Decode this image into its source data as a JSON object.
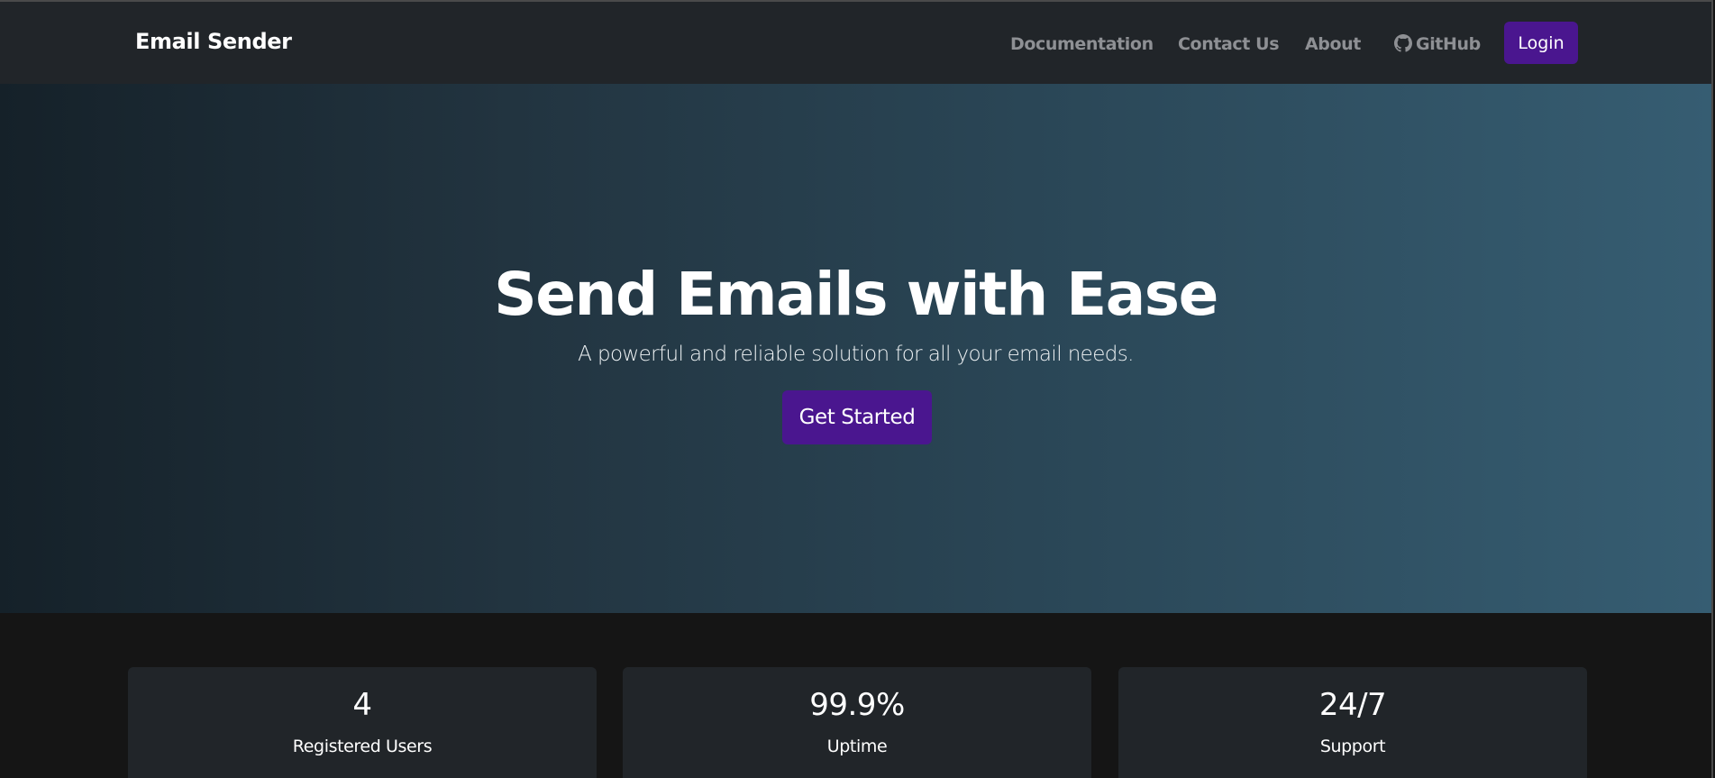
{
  "navbar": {
    "brand": "Email Sender",
    "links": {
      "documentation": "Documentation",
      "contact": "Contact Us",
      "about": "About",
      "github": "GitHub"
    },
    "github_icon": "github-icon",
    "login_label": "Login"
  },
  "hero": {
    "title": "Send Emails with Ease",
    "subtitle": "A powerful and reliable solution for all your email needs.",
    "cta_label": "Get Started"
  },
  "stats": [
    {
      "value": "4",
      "label": "Registered Users"
    },
    {
      "value": "99.9%",
      "label": "Uptime"
    },
    {
      "value": "24/7",
      "label": "Support"
    }
  ],
  "colors": {
    "accent": "#4a168f",
    "navbar_bg": "#212529",
    "hero_gradient_start": "#152129",
    "hero_gradient_end": "#365d72",
    "page_bg": "#151515",
    "card_bg": "#212529",
    "nav_link": "#8e9094"
  }
}
